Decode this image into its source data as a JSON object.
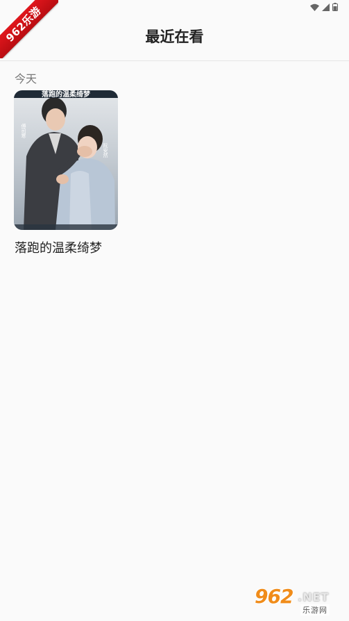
{
  "ribbon": {
    "text": "962乐游"
  },
  "status_bar": {
    "icons": [
      "wifi-icon",
      "signal-icon",
      "battery-icon"
    ]
  },
  "header": {
    "title": "最近在看"
  },
  "history": {
    "section_label": "今天",
    "items": [
      {
        "title": "落跑的温柔绮梦",
        "poster": {
          "header_text": "落跑的温柔绮梦",
          "actor_left": "傅司寒",
          "actor_right": "阮安然"
        }
      }
    ]
  },
  "watermark": {
    "main": "962",
    "suffix": ".NET",
    "sub": "乐游网"
  },
  "colors": {
    "background": "#fafafa",
    "ribbon": "#d01218",
    "watermark_orange": "#f08c1a"
  }
}
